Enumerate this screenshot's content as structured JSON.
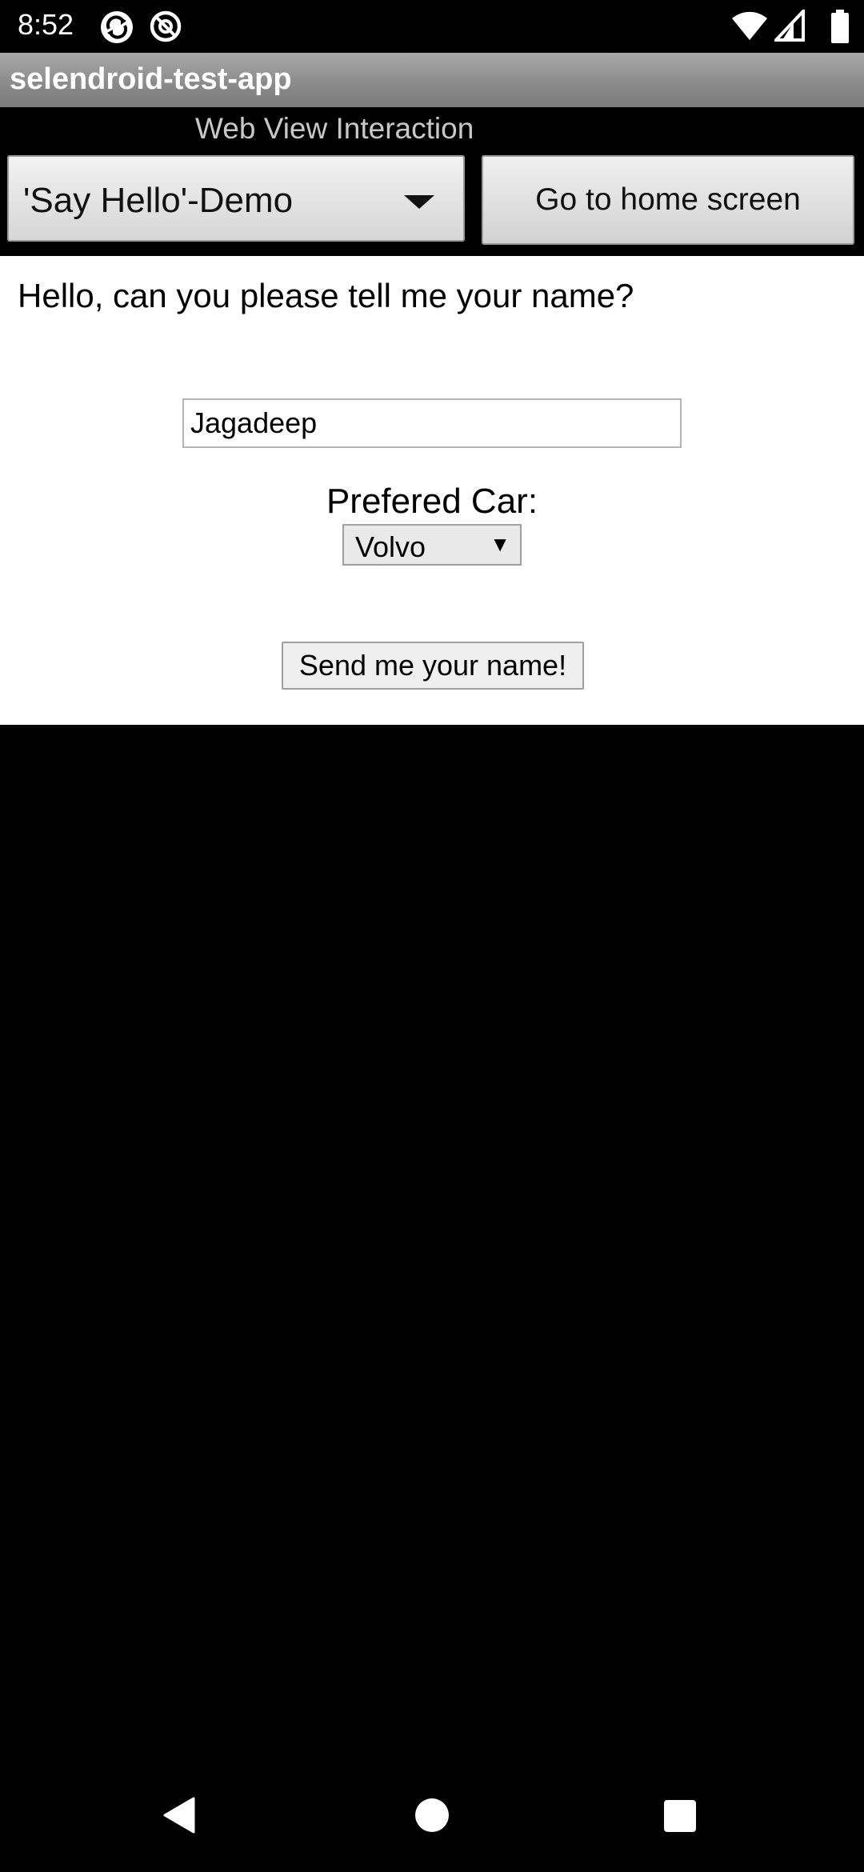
{
  "status_bar": {
    "time": "8:52",
    "left_icons": [
      "sync-icon",
      "at-sign-icon"
    ],
    "right_icons": [
      "wifi-icon",
      "cell-signal-icon",
      "battery-icon"
    ]
  },
  "app": {
    "title": "selendroid-test-app"
  },
  "top": {
    "subtitle": "Web View Interaction",
    "spinner_value": "'Say Hello'-Demo",
    "home_button_label": "Go to home screen"
  },
  "webview": {
    "question": "Hello, can you please tell me your name?",
    "name_value": "Jagadeep",
    "car_label": "Prefered Car:",
    "car_selected": "Volvo",
    "send_button_label": "Send me your name!"
  },
  "nav_bar": {
    "icons": [
      "back-icon",
      "home-icon",
      "recents-icon"
    ]
  }
}
